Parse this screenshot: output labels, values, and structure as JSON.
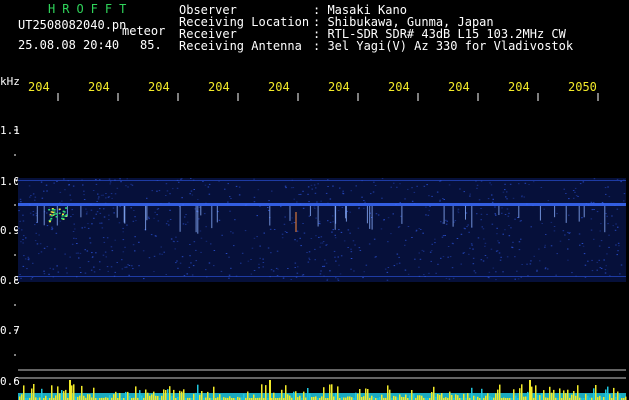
{
  "header": {
    "brand": "HROFFT",
    "filename": "UT2508082040.pn",
    "mode": "meteor",
    "datetime": "25.08.08 20:40",
    "count": "85."
  },
  "info": [
    {
      "label": "Observer",
      "value": ": Masaki Kano"
    },
    {
      "label": "Receiving Location",
      "value": ": Shibukawa, Gunma, Japan"
    },
    {
      "label": "Receiver",
      "value": ": RTL-SDR SDR# 43dB L15 103.2MHz CW"
    },
    {
      "label": "Receiving Antenna",
      "value": ": 3el Yagi(V) Az 330 for Vladivostok"
    }
  ],
  "axis": {
    "y_unit": "kHz",
    "y_labels": [
      "1.1",
      "1.0",
      "0.9",
      "0.8",
      "0.7",
      "0.6"
    ],
    "x_labels": [
      "204",
      "204",
      "204",
      "204",
      "204",
      "204",
      "204",
      "204",
      "204",
      "2050"
    ]
  },
  "colors": {
    "brand": "#2fd35a",
    "text": "#ffffff",
    "minute_labels": "#f2ea2a",
    "signal": "#2a4fd0",
    "histogram": "#f2ea2a",
    "baseline": "#20c8e0"
  }
}
